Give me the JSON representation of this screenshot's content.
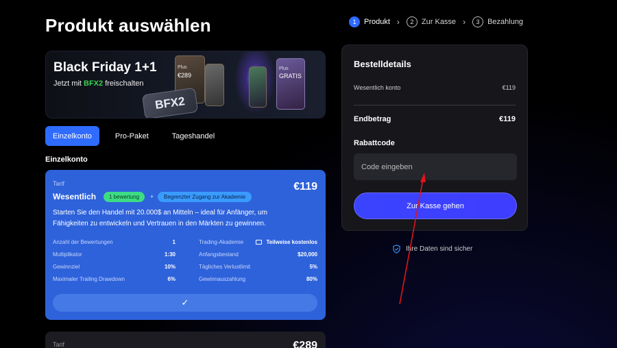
{
  "page": {
    "title": "Produkt auswählen"
  },
  "stepper": [
    {
      "num": "1",
      "label": "Produkt",
      "active": true
    },
    {
      "num": "2",
      "label": "Zur Kasse",
      "active": false
    },
    {
      "num": "3",
      "label": "Bezahlung",
      "active": false
    }
  ],
  "banner": {
    "title": "Black Friday 1+1",
    "sub_prefix": "Jetzt mit ",
    "code": "BFX2",
    "sub_suffix": " freischalten",
    "badge": "BFX2",
    "card1_plus": "Plus",
    "card1_price": "€289",
    "card2_plus": "Plus",
    "card2_text": "GRATIS"
  },
  "tabs": [
    "Einzelkonto",
    "Pro-Paket",
    "Tageshandel"
  ],
  "active_tab": 0,
  "section_label": "Einzelkonto",
  "tariff": {
    "label": "Tarif",
    "name": "Wesentlich",
    "badge1": "1 bewertung",
    "plus": "+",
    "badge2": "Begrenzter Zugang zur Akademie",
    "price": "€119",
    "description": "Starten Sie den Handel mit 20.000$ an Mitteln – ideal für Anfänger, um Fähigkeiten zu entwickeln und Vertrauen in den Märkten zu gewinnen.",
    "rows": [
      {
        "k1": "Anzahl der Bewertungen",
        "v1": "1",
        "k2": "Trading-Akademie",
        "v2": "Teilweise kostenlos"
      },
      {
        "k1": "Multiplikator",
        "v1": "1:30",
        "k2": "Anfangsbestand",
        "v2": "$20,000"
      },
      {
        "k1": "Gewinnziel",
        "v1": "10%",
        "k2": "Tägliches Verlustlimit",
        "v2": "5%"
      },
      {
        "k1": "Maximaler Trailing Drawdown",
        "v1": "6%",
        "k2": "Gewinnauszahlung",
        "v2": "80%"
      }
    ],
    "selected_mark": "✓"
  },
  "tariff2": {
    "label": "Tarif",
    "price": "€289"
  },
  "order": {
    "title": "Bestelldetails",
    "item_label": "Wesentlich konto",
    "item_price": "€119",
    "total_label": "Endbetrag",
    "total_price": "€119",
    "coupon_label": "Rabattcode",
    "coupon_placeholder": "Code eingeben",
    "coupon_value": "",
    "checkout_button": "Zur Kasse gehen"
  },
  "secure_text": "Ihre Daten sind sicher",
  "colors": {
    "accent": "#2f6bff",
    "card": "#2e62db",
    "annotation": "#e0151b"
  }
}
